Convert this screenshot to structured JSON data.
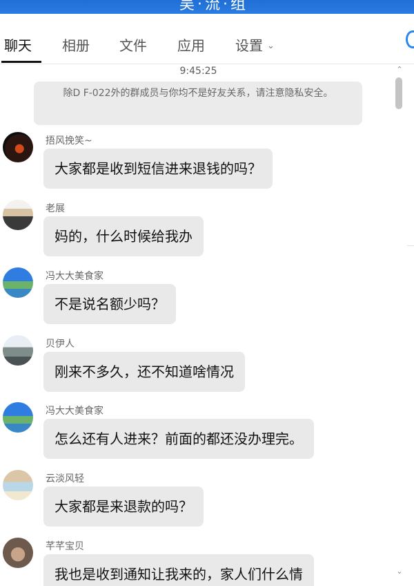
{
  "window": {
    "title": "吴·流·组"
  },
  "tabs": [
    {
      "label": "聊天",
      "active": true
    },
    {
      "label": "相册"
    },
    {
      "label": "文件"
    },
    {
      "label": "应用"
    },
    {
      "label": "设置",
      "dropdown_icon": "chevron-down-icon"
    }
  ],
  "chat": {
    "timestamp": "9:45:25",
    "notice": "除D F-022外的群成员与你均不是好友关系，请注意隐私安全。",
    "messages": [
      {
        "sender": "捂风挽笑~",
        "text": "大家都是收到短信进来退钱的吗？"
      },
      {
        "sender": "老展",
        "text": "妈的，什么时候给我办"
      },
      {
        "sender": "冯大大美食家",
        "text": "不是说名额少吗？"
      },
      {
        "sender": "贝伊人",
        "text": "刚来不多久，还不知道啥情况"
      },
      {
        "sender": "冯大大美食家",
        "text": "怎么还有人进来？前面的都还没办理完。"
      },
      {
        "sender": "云淡风轻",
        "text": "大家都是来退款的吗？"
      },
      {
        "sender": "芊芊宝贝",
        "text": "我也是收到通知让我来的，家人们什么情"
      }
    ]
  },
  "colors": {
    "accent": "#2a7be0",
    "bubble": "#e9e9e9",
    "notice_bg": "#ebebeb"
  }
}
